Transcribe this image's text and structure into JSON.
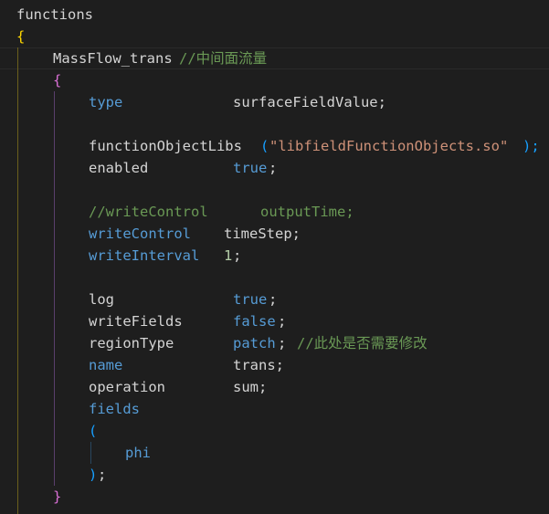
{
  "colors": {
    "background": "#1e1e1e",
    "plain": "#d4d4d4",
    "keyword_blue": "#569cd6",
    "value_blue": "#569cd6",
    "string": "#ce9178",
    "comment": "#6a9955",
    "number": "#b5cea8",
    "bracket_gold": "#ffd700",
    "bracket_purple": "#da70d6",
    "bracket_blue": "#179fff",
    "cyan": "#4fc1ff"
  },
  "code": {
    "l01": "functions",
    "l02": "{",
    "l03_name": "MassFlow_trans",
    "l03_comment": "//中间面流量",
    "l04": "{",
    "l05_key": "type",
    "l05_val": "surfaceFieldValue;",
    "l07_key": "functionObjectLibs",
    "l07_open": "(",
    "l07_str": "\"libfieldFunctionObjects.so\"",
    "l07_close": ");",
    "l08_key": "enabled",
    "l08_val": "true",
    "l08_semi": ";",
    "l10_comment_a": "//writeControl",
    "l10_comment_b": "outputTime;",
    "l11_key": "writeControl",
    "l11_val": "timeStep;",
    "l12_key": "writeInterval",
    "l12_val": "1",
    "l12_semi": ";",
    "l14_key": "log",
    "l14_val": "true",
    "l14_semi": ";",
    "l15_key": "writeFields",
    "l15_val": "false",
    "l15_semi": ";",
    "l16_key": "regionType",
    "l16_val": "patch",
    "l16_semi": ";",
    "l16_comment": "//此处是否需要修改",
    "l17_key": "name",
    "l17_val": "trans;",
    "l18_key": "operation",
    "l18_val": "sum;",
    "l19_key": "fields",
    "l20": "(",
    "l21": "phi",
    "l22_paren": ")",
    "l22_semi": ";",
    "l23": "}"
  }
}
